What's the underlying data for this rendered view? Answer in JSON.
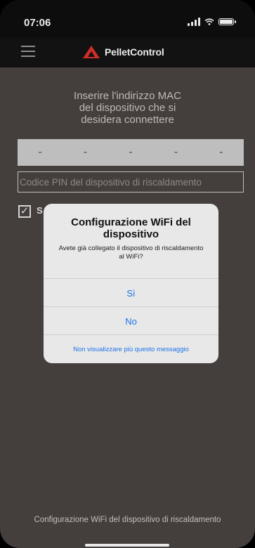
{
  "status_bar": {
    "time": "07:06"
  },
  "header": {
    "app_name": "PelletControl"
  },
  "main": {
    "instructions": "Inserire l'indirizzo MAC\ndel dispositivo che si\ndesidera connettere",
    "mac_segments": [
      "-",
      "-",
      "-",
      "-",
      "-"
    ],
    "pin_placeholder": "Codice PIN del dispositivo di riscaldamento",
    "checkbox_label": "S",
    "footer": "Configurazione WiFi del dispositivo di riscaldamento"
  },
  "dialog": {
    "title": "Configurazione WiFi del dispositivo",
    "message": "Avete già collegato il dispositivo di riscaldamento al WiFi?",
    "yes_label": "Sì",
    "no_label": "No",
    "dont_show_label": "Non visualizzare più questo messaggio"
  },
  "colors": {
    "accent": "#1a73e8",
    "brand_red": "#e0322c",
    "background": "#4a4442"
  }
}
